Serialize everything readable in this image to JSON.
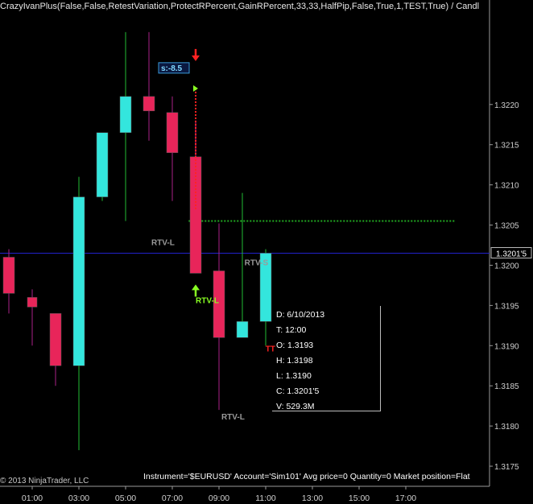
{
  "header": {
    "indicator_text": "CrazyIvanPlus(False,False,RetestVariation,ProtectRPercent,GainRPercent,33,33,HalfPip,False,True,1,TEST,True) / Candl"
  },
  "footer": {
    "copyright": "© 2013 NinjaTrader, LLC",
    "status_line": "Instrument='$EURUSD' Account='Sim101' Avg price=0 Quantity=0 Market position=Flat"
  },
  "tooltip": {
    "date": "D: 6/10/2013",
    "time": "T: 12:00",
    "open": "O: 1.3193",
    "high": "H: 1.3198",
    "low": "L: 1.3190",
    "close": "C: 1.3201'5",
    "volume": "V: 529.3M"
  },
  "colors": {
    "background": "#000000",
    "up_candle": "#33e6dd",
    "down_candle": "#e8255a",
    "wick_up": "#22bb33",
    "wick_down": "#aa2288",
    "last_price_line": "#2222cc",
    "target_line": "#22aa22",
    "signal_green": "#88ff22",
    "signal_red": "#ff2222"
  },
  "chart_data": {
    "type": "candlestick",
    "instrument": "$EURUSD",
    "y_ticks": [
      "1.3220",
      "1.3215",
      "1.3210",
      "1.3205",
      "1.3200",
      "1.3195",
      "1.3190",
      "1.3185",
      "1.3180",
      "1.3175"
    ],
    "y_range": [
      1.31725,
      1.3233
    ],
    "x_ticks": [
      "01:00",
      "03:00",
      "05:00",
      "07:00",
      "09:00",
      "11:00",
      "13:00",
      "15:00",
      "17:00"
    ],
    "last_price_label": "1.3201'5",
    "candles": [
      {
        "t": "00:00",
        "o": 1.3201,
        "h": 1.3202,
        "l": 1.3194,
        "c": 1.31965
      },
      {
        "t": "01:00",
        "o": 1.3196,
        "h": 1.3197,
        "l": 1.319,
        "c": 1.31948
      },
      {
        "t": "02:00",
        "o": 1.3194,
        "h": 1.3194,
        "l": 1.3185,
        "c": 1.31875
      },
      {
        "t": "03:00",
        "o": 1.31875,
        "h": 1.3211,
        "l": 1.3177,
        "c": 1.32085
      },
      {
        "t": "04:00",
        "o": 1.32085,
        "h": 1.3212,
        "l": 1.3208,
        "c": 1.32165
      },
      {
        "t": "05:00",
        "o": 1.32165,
        "h": 1.3229,
        "l": 1.32055,
        "c": 1.3221
      },
      {
        "t": "06:00",
        "o": 1.3221,
        "h": 1.3229,
        "l": 1.32155,
        "c": 1.32192
      },
      {
        "t": "07:00",
        "o": 1.3219,
        "h": 1.3221,
        "l": 1.3208,
        "c": 1.3214
      },
      {
        "t": "08:00",
        "o": 1.32135,
        "h": 1.3218,
        "l": 1.3199,
        "c": 1.3199
      },
      {
        "t": "09:00",
        "o": 1.31993,
        "h": 1.32052,
        "l": 1.3182,
        "c": 1.3191
      },
      {
        "t": "10:00",
        "o": 1.3191,
        "h": 1.3209,
        "l": 1.3191,
        "c": 1.3193
      },
      {
        "t": "11:00",
        "o": 1.3193,
        "h": 1.3202,
        "l": 1.319,
        "c": 1.32015
      }
    ],
    "horizontal_lines": [
      {
        "name": "last-price",
        "price": 1.32015
      },
      {
        "name": "target",
        "price": 1.32055
      }
    ],
    "annotations": [
      {
        "text": "s:-8.5",
        "candle": 8,
        "price": 1.32244
      },
      {
        "text": "RTV-L",
        "candle": 6.6,
        "price": 1.32025
      },
      {
        "text": "RTV-L",
        "candle": 8.5,
        "price": 1.31953
      },
      {
        "text": "RTV-L",
        "candle": 9.6,
        "price": 1.31808
      },
      {
        "text": "RTV-S",
        "candle": 10.6,
        "price": 1.32
      },
      {
        "text": "TT",
        "candle": 11.2,
        "price": 1.31893
      }
    ],
    "signal_arrows": [
      {
        "name": "sell-arrow",
        "candle": 8,
        "price": 1.3226,
        "direction": "down"
      },
      {
        "name": "buy-arrow",
        "candle": 8,
        "price": 1.3197,
        "direction": "up"
      },
      {
        "name": "entry-marker",
        "candle": 8,
        "price": 1.3222,
        "direction": "right"
      }
    ]
  }
}
